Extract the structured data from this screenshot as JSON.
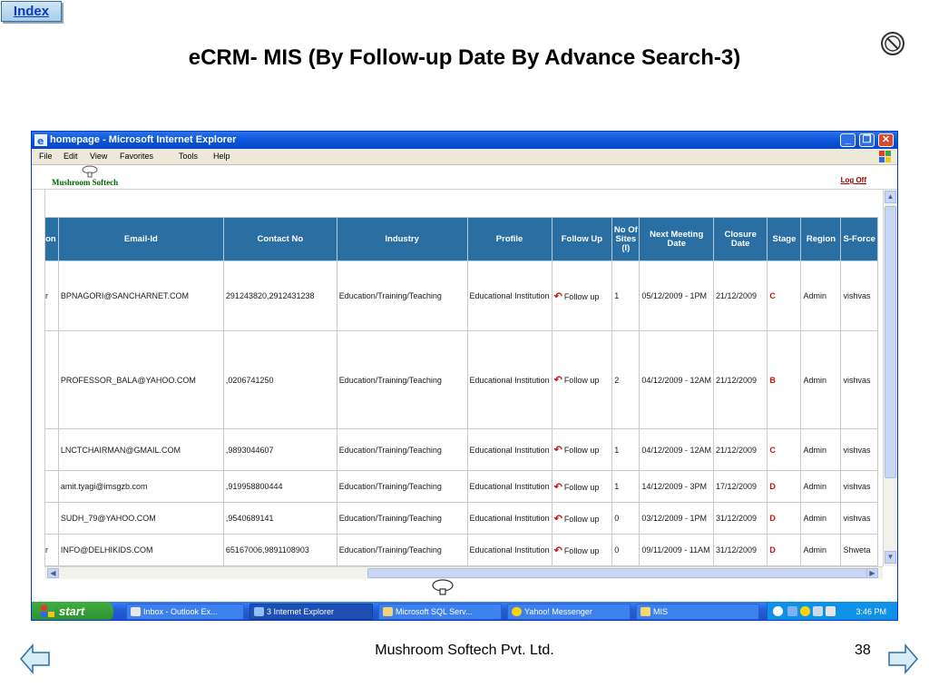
{
  "slide": {
    "index_label": "Index",
    "title": "eCRM- MIS (By Follow-up Date By Advance Search-3)",
    "footer_company": "Mushroom Softech Pvt. Ltd.",
    "page_number": "38"
  },
  "browser": {
    "title": "homepage - Microsoft Internet Explorer",
    "menu": [
      "File",
      "Edit",
      "View",
      "Favorites",
      "Tools",
      "Help"
    ],
    "brand": "Mushroom Softech",
    "logoff_label": "Log Off"
  },
  "table": {
    "headers": {
      "partial": "on",
      "email": "Email-Id",
      "contact": "Contact No",
      "industry": "Industry",
      "profile": "Profile",
      "followup": "Follow Up",
      "sites": "No Of Sites (I)",
      "meeting": "Next Meeting Date",
      "closure": "Closure Date",
      "stage": "Stage",
      "region": "Region",
      "sforce": "S-Force"
    },
    "rows": [
      {
        "partial": "r",
        "email": "BPNAGORI@SANCHARNET.COM",
        "contact": "291243820,2912431238",
        "industry": "Education/Training/Teaching",
        "profile": "Educational Institution",
        "followup": "Follow up",
        "sites": "1",
        "meeting": "05/12/2009 - 1PM",
        "closure": "21/12/2009",
        "stage": "C",
        "region": "Admin",
        "sforce": "vishvas"
      },
      {
        "partial": "",
        "email": "PROFESSOR_BALA@YAHOO.COM",
        "contact": ",0206741250",
        "industry": "Education/Training/Teaching",
        "profile": "Educational Institution",
        "followup": "Follow up",
        "sites": "2",
        "meeting": "04/12/2009 - 12AM",
        "closure": "21/12/2009",
        "stage": "B",
        "region": "Admin",
        "sforce": "vishvas"
      },
      {
        "partial": "",
        "email": "LNCTCHAIRMAN@GMAIL.COM",
        "contact": ",9893044607",
        "industry": "Education/Training/Teaching",
        "profile": "Educational Institution",
        "followup": "Follow up",
        "sites": "1",
        "meeting": "04/12/2009 - 12AM",
        "closure": "21/12/2009",
        "stage": "C",
        "region": "Admin",
        "sforce": "vishvas"
      },
      {
        "partial": "",
        "email": "amit.tyagi@imsgzb.com",
        "contact": ",919958800444",
        "industry": "Education/Training/Teaching",
        "profile": "Educational Institution",
        "followup": "Follow up",
        "sites": "1",
        "meeting": "14/12/2009 - 3PM",
        "closure": "17/12/2009",
        "stage": "D",
        "region": "Admin",
        "sforce": "vishvas"
      },
      {
        "partial": "",
        "email": "SUDH_79@YAHOO.COM",
        "contact": ",9540689141",
        "industry": "Education/Training/Teaching",
        "profile": "Educational Institution",
        "followup": "Follow up",
        "sites": "0",
        "meeting": "03/12/2009 - 1PM",
        "closure": "31/12/2009",
        "stage": "D",
        "region": "Admin",
        "sforce": "vishvas"
      },
      {
        "partial": "r",
        "email": "INFO@DELHIKIDS.COM",
        "contact": "65167006,9891108903",
        "industry": "Education/Training/Teaching",
        "profile": "Educational Institution",
        "followup": "Follow up",
        "sites": "0",
        "meeting": "09/11/2009 - 11AM",
        "closure": "31/12/2009",
        "stage": "D",
        "region": "Admin",
        "sforce": "Shweta"
      }
    ]
  },
  "taskbar": {
    "start_label": "start",
    "tasks": [
      "Inbox - Outlook Ex...",
      "3 Internet Explorer",
      "Microsoft SQL Serv...",
      "Yahoo! Messenger",
      "MIS"
    ],
    "clock": "3:46 PM"
  }
}
